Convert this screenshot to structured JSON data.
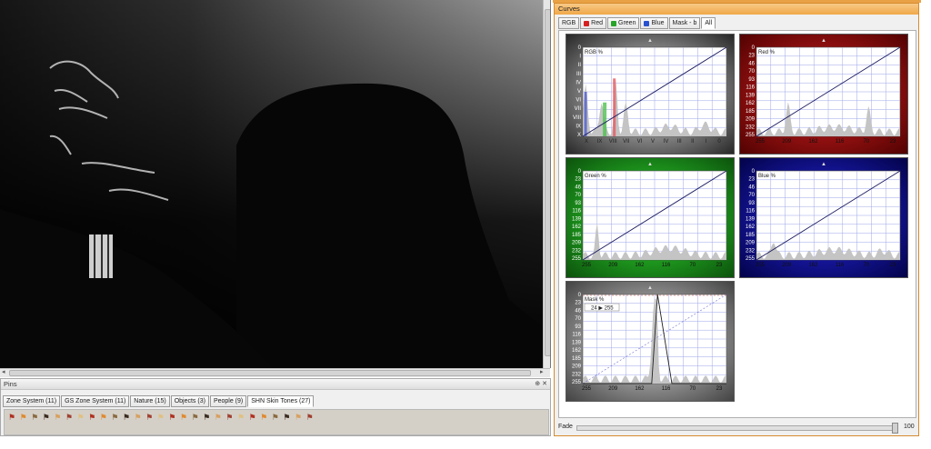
{
  "window": {
    "curves_title": "Curves",
    "pins_title": "Pins"
  },
  "pins": {
    "tabs": [
      {
        "label": "Zone System (11)"
      },
      {
        "label": "GS Zone System (11)"
      },
      {
        "label": "Nature (15)"
      },
      {
        "label": "Objects (3)"
      },
      {
        "label": "People (9)"
      },
      {
        "label": "SHN Skin Tones (27)"
      }
    ],
    "active_tab": 5,
    "pin_count": 27
  },
  "curves": {
    "tabs": [
      {
        "label": "RGB",
        "icon": "",
        "color": ""
      },
      {
        "label": "Red",
        "icon": "red-channel-icon",
        "color": "#d62020"
      },
      {
        "label": "Green",
        "icon": "green-channel-icon",
        "color": "#28a428"
      },
      {
        "label": "Blue",
        "icon": "blue-channel-icon",
        "color": "#2850d0"
      },
      {
        "label": "Mask - b",
        "icon": "",
        "color": ""
      },
      {
        "label": "All",
        "icon": "",
        "color": ""
      }
    ],
    "active_tab": 5,
    "panels": {
      "rgb": {
        "label": "RGB %",
        "y_ticks": [
          "0",
          "I",
          "II",
          "III",
          "IV",
          "V",
          "VI",
          "VII",
          "VIII",
          "IX",
          "X"
        ],
        "x_ticks": [
          "X",
          "IX",
          "VIII",
          "VII",
          "VI",
          "V",
          "IV",
          "III",
          "II",
          "I",
          "0"
        ],
        "color": "#555555"
      },
      "red": {
        "label": "Red %",
        "y_ticks": [
          "0",
          "23",
          "46",
          "70",
          "93",
          "116",
          "139",
          "162",
          "185",
          "209",
          "232",
          "255"
        ],
        "x_ticks": [
          "255",
          "209",
          "162",
          "116",
          "70",
          "23"
        ],
        "color": "#c00000"
      },
      "green": {
        "label": "Green %",
        "y_ticks": [
          "0",
          "23",
          "46",
          "70",
          "93",
          "116",
          "139",
          "162",
          "185",
          "209",
          "232",
          "255"
        ],
        "x_ticks": [
          "255",
          "209",
          "162",
          "116",
          "70",
          "23"
        ],
        "color": "#10b010"
      },
      "blue": {
        "label": "Blue %",
        "y_ticks": [
          "0",
          "23",
          "46",
          "70",
          "93",
          "116",
          "139",
          "162",
          "185",
          "209",
          "232",
          "255"
        ],
        "x_ticks": [
          "255",
          "209",
          "162",
          "116",
          "70",
          "23"
        ],
        "color": "#1010c0"
      },
      "mask": {
        "label": "Mask %",
        "readout": "24 ▶ 255",
        "y_ticks": [
          "0",
          "23",
          "46",
          "70",
          "93",
          "116",
          "139",
          "162",
          "185",
          "209",
          "232",
          "255"
        ],
        "x_ticks": [
          "255",
          "209",
          "162",
          "116",
          "70",
          "23"
        ],
        "color": "#707070"
      }
    },
    "fade": {
      "label": "Fade",
      "value": "100"
    }
  }
}
